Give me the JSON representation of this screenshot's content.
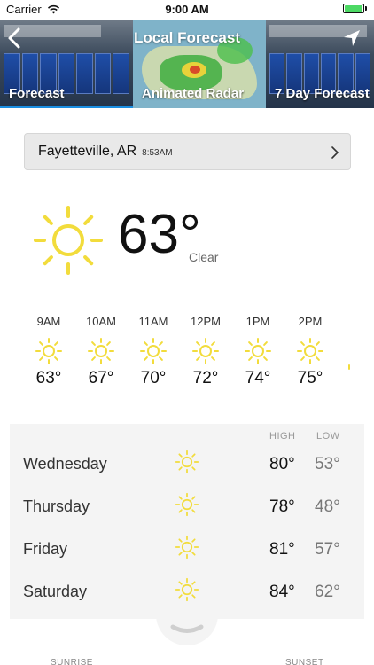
{
  "status_bar": {
    "carrier": "Carrier",
    "time": "9:00 AM"
  },
  "nav": {
    "title": "Local Forecast"
  },
  "thumbnails": [
    {
      "label": "Forecast",
      "active": true
    },
    {
      "label": "Animated Radar",
      "active": false
    },
    {
      "label": "7 Day Forecast",
      "active": false
    }
  ],
  "location": {
    "city": "Fayetteville, AR",
    "time": "8:53AM"
  },
  "current": {
    "temp": "63°",
    "condition": "Clear",
    "icon": "sun-icon"
  },
  "hourly": [
    {
      "time": "9AM",
      "temp": "63°"
    },
    {
      "time": "10AM",
      "temp": "67°"
    },
    {
      "time": "11AM",
      "temp": "70°"
    },
    {
      "time": "12PM",
      "temp": "72°"
    },
    {
      "time": "1PM",
      "temp": "74°"
    },
    {
      "time": "2PM",
      "temp": "75°"
    }
  ],
  "daily": {
    "high_label": "HIGH",
    "low_label": "LOW",
    "days": [
      {
        "name": "Wednesday",
        "high": "80°",
        "low": "53°"
      },
      {
        "name": "Thursday",
        "high": "78°",
        "low": "48°"
      },
      {
        "name": "Friday",
        "high": "81°",
        "low": "57°"
      },
      {
        "name": "Saturday",
        "high": "84°",
        "low": "62°"
      }
    ]
  },
  "sun_times": {
    "sunrise_label": "SUNRISE",
    "sunset_label": "SUNSET"
  },
  "colors": {
    "sun": "#f2dc3c",
    "accent": "#1a8fe3",
    "battery": "#4cd964"
  }
}
